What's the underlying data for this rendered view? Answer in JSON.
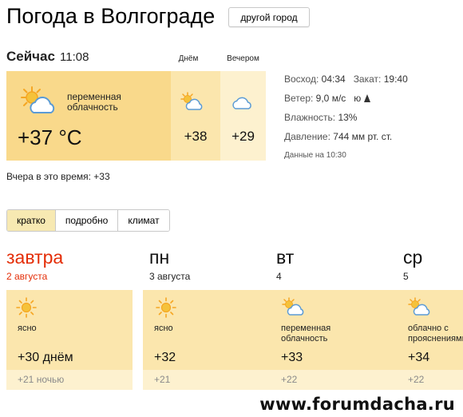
{
  "header": {
    "title": "Погода в Волгограде",
    "city_button": "другой город"
  },
  "now": {
    "label": "Сейчас",
    "time": "11:08",
    "condition": "переменная облачность",
    "temp": "+37 °C",
    "day_label": "Днём",
    "day_temp": "+38",
    "evening_label": "Вечером",
    "evening_temp": "+29",
    "icons": {
      "now": "partly-cloudy-icon",
      "day": "partly-cloudy-icon",
      "evening": "cloud-icon"
    },
    "yesterday": "Вчера в это время: +33"
  },
  "details": {
    "sunrise_label": "Восход:",
    "sunrise": "04:34",
    "sunset_label": "Закат:",
    "sunset": "19:40",
    "wind_label": "Ветер:",
    "wind": "9,0 м/с",
    "wind_dir": "ю",
    "humidity_label": "Влажность:",
    "humidity": "13%",
    "pressure_label": "Давление:",
    "pressure": "744 мм рт. ст.",
    "data_time": "Данные на 10:30"
  },
  "tabs": [
    {
      "label": "кратко",
      "active": true
    },
    {
      "label": "подробно",
      "active": false
    },
    {
      "label": "климат",
      "active": false
    }
  ],
  "forecast": [
    {
      "name": "завтра",
      "date": "2 августа",
      "condition": "ясно",
      "day_temp": "+30 днём",
      "night_temp": "+21 ночью",
      "icon": "sun-icon",
      "highlight": true
    },
    {
      "name": "пн",
      "date": "3 августа",
      "condition": "ясно",
      "day_temp": "+32",
      "night_temp": "+21",
      "icon": "sun-icon",
      "highlight": false
    },
    {
      "name": "вт",
      "date": "4",
      "condition": "переменная облачность",
      "day_temp": "+33",
      "night_temp": "+22",
      "icon": "partly-cloudy-icon",
      "highlight": false
    },
    {
      "name": "ср",
      "date": "5",
      "condition": "облачно с прояснениями",
      "day_temp": "+34",
      "night_temp": "+22",
      "icon": "partly-cloudy-icon",
      "highlight": false
    }
  ],
  "watermark": "www.forumdacha.ru",
  "colors": {
    "accent_red": "#e42d07",
    "card_dark": "#f9d98b",
    "card_mid": "#fbe6ad",
    "card_light": "#fdf1cf",
    "icon_orange": "#f5a623",
    "icon_blue": "#5b9bd5"
  }
}
